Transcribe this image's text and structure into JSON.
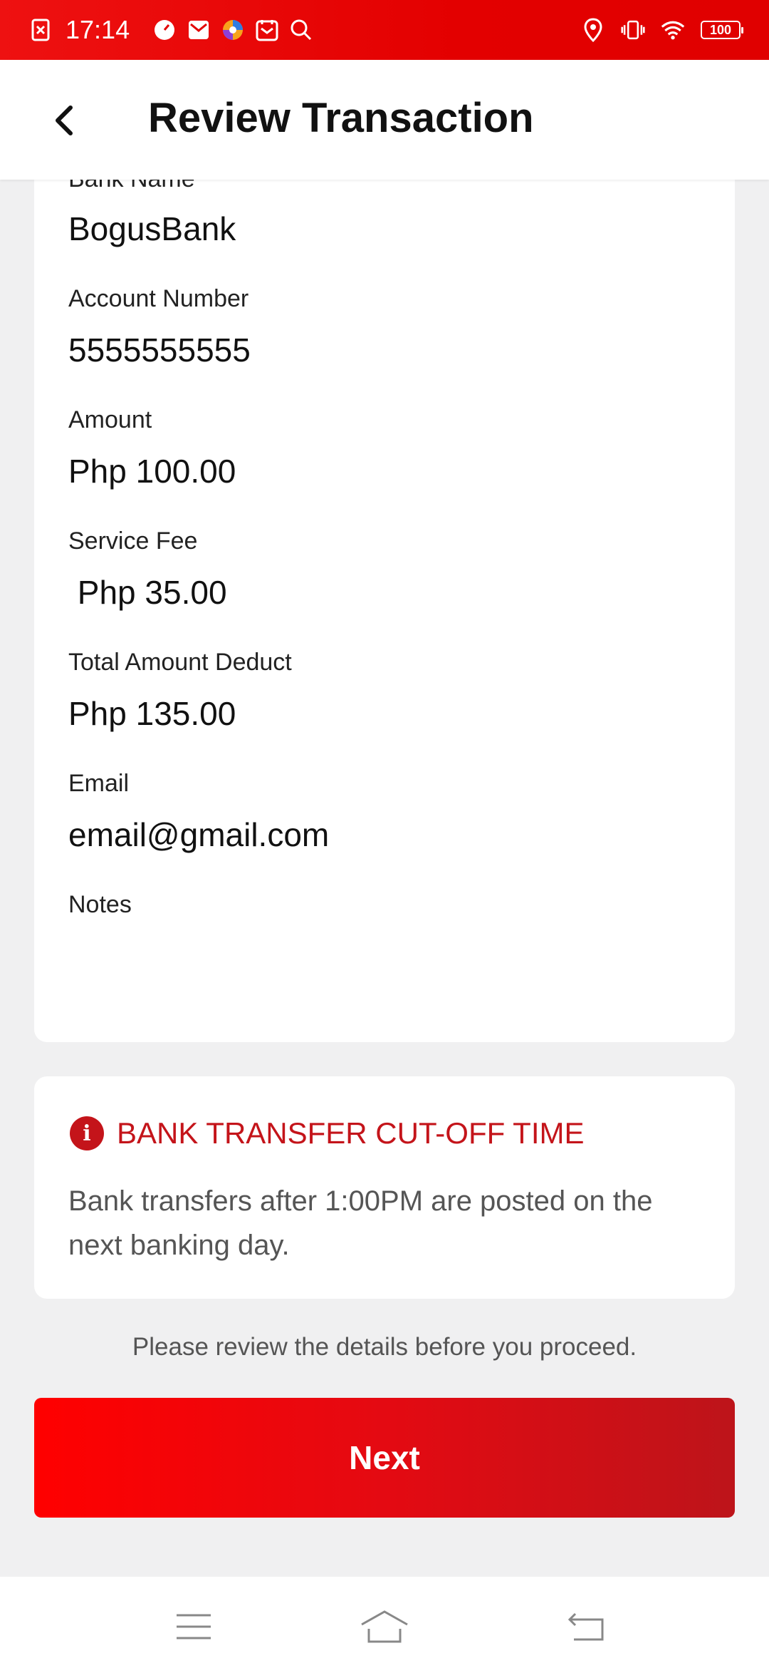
{
  "status_bar": {
    "time": "17:14",
    "battery": "100",
    "icons_left": [
      "screenshot-icon",
      "speedometer-icon",
      "mail-icon",
      "browser-icon",
      "calendar-icon",
      "search-icon"
    ],
    "icons_right": [
      "location-icon",
      "vibrate-icon",
      "wifi-icon",
      "battery-icon"
    ]
  },
  "header": {
    "title": "Review Transaction"
  },
  "details": {
    "bank_name": {
      "label": "Bank Name",
      "value": "BogusBank"
    },
    "account_number": {
      "label": "Account Number",
      "value": "5555555555"
    },
    "amount": {
      "label": "Amount",
      "value": "Php 100.00"
    },
    "service_fee": {
      "label": "Service Fee",
      "value": " Php 35.00"
    },
    "total": {
      "label": "Total Amount Deduct",
      "value": "Php 135.00"
    },
    "email": {
      "label": "Email",
      "value": "email@gmail.com"
    },
    "notes": {
      "label": "Notes",
      "value": ""
    }
  },
  "cutoff": {
    "title": "BANK TRANSFER CUT-OFF TIME",
    "text": "Bank transfers after 1:00PM are posted on the next banking day."
  },
  "review_note": "Please review the details before you proceed.",
  "next_button": "Next",
  "colors": {
    "brand_red": "#e30000",
    "accent_red": "#c4141a",
    "background": "#f0f0f1"
  }
}
